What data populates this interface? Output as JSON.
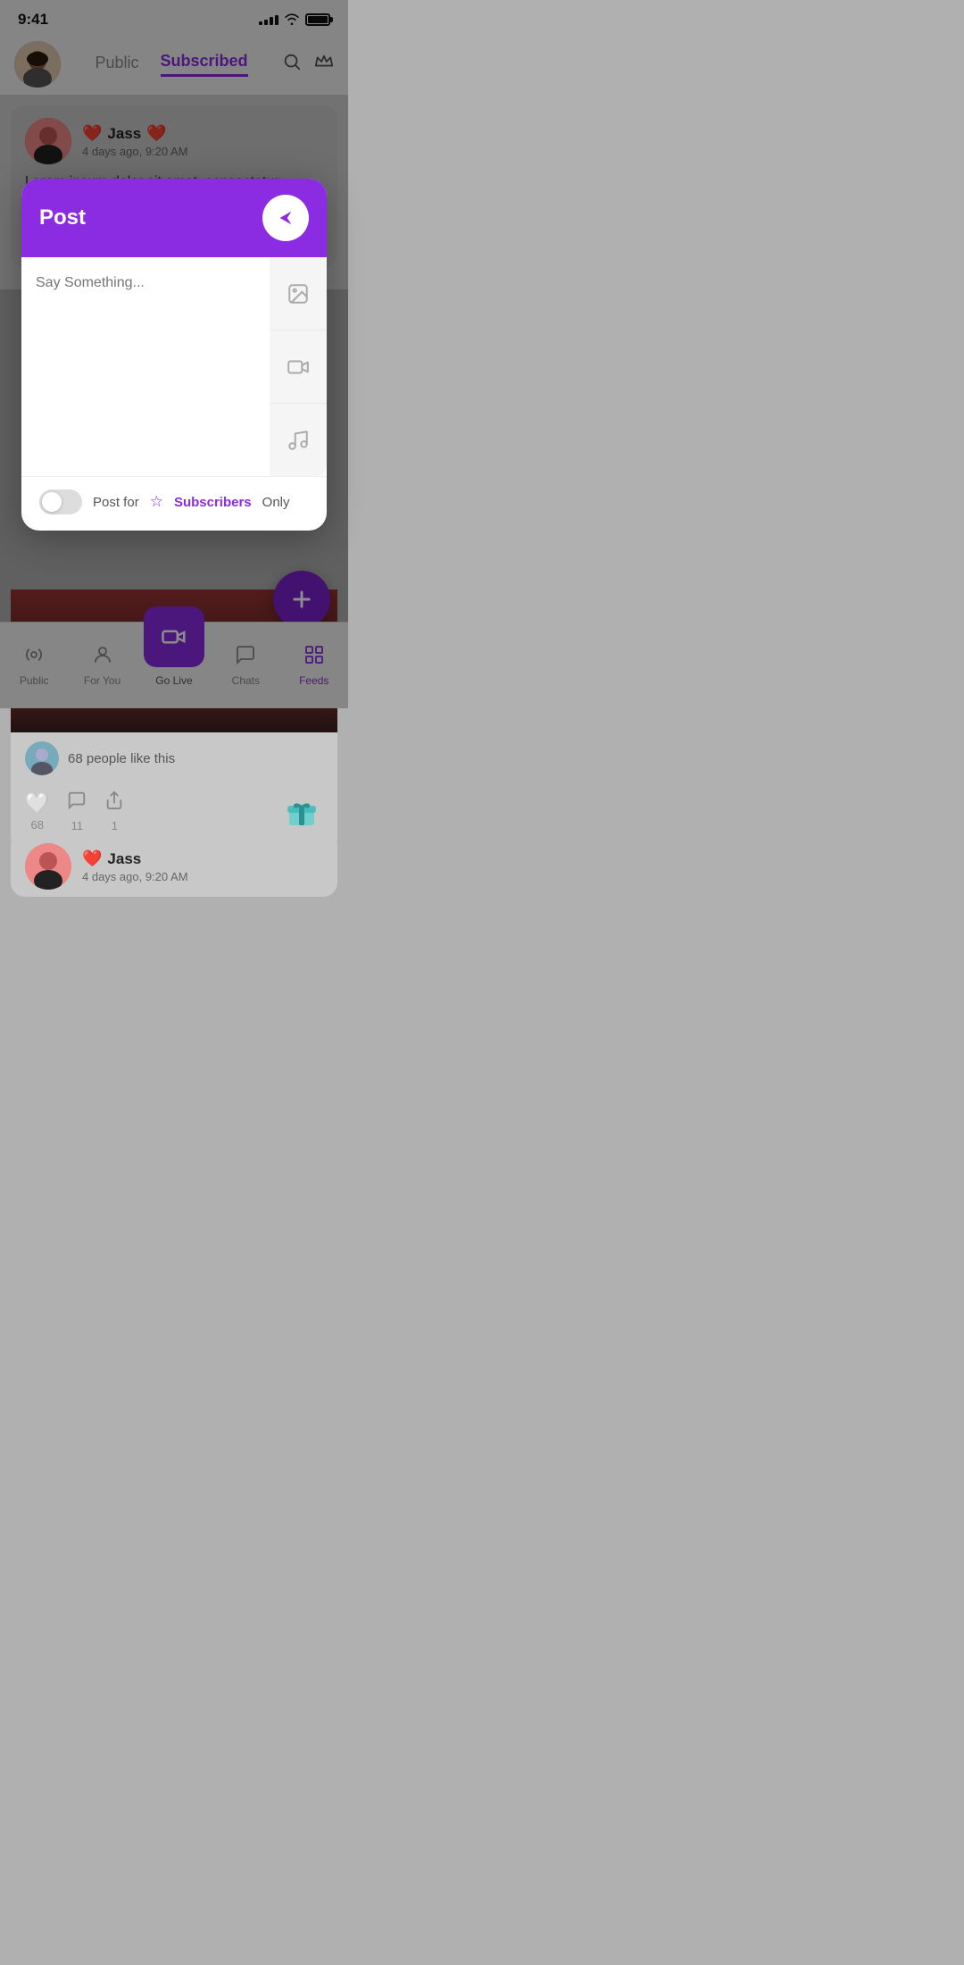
{
  "statusBar": {
    "time": "9:41",
    "signalBars": [
      3,
      5,
      7,
      9,
      11
    ],
    "battery": "full"
  },
  "header": {
    "tabs": [
      {
        "id": "public",
        "label": "Public",
        "active": false
      },
      {
        "id": "subscribed",
        "label": "Subscribed",
        "active": true
      }
    ],
    "searchIcon": "search",
    "crownIcon": "crown"
  },
  "posts": [
    {
      "author": "Jass",
      "time": "4 days ago, 9:20 AM",
      "text": "Lorem ipsum dolor sit amet, consectetur adipisicing elit, sed do eiusmod tempor incididunt  quis nostrud exercitation ullamco laboris nisi ut 🧡💛🧡",
      "likes": 68,
      "comments": 11,
      "shares": 1,
      "likeText": "68 people like this"
    },
    {
      "author": "Jass",
      "time": "4 days ago, 9:20 AM"
    }
  ],
  "modal": {
    "title": "Post",
    "placeholder": "Say Something...",
    "sendIcon": "send",
    "imageIcon": "image",
    "videoIcon": "video",
    "musicIcon": "music",
    "toggleLabel": "Post for",
    "subscribersLabel": "Subscribers",
    "onlyLabel": "Only",
    "toggleOn": false
  },
  "bottomNav": [
    {
      "id": "public",
      "label": "Public",
      "icon": "broadcast",
      "active": false
    },
    {
      "id": "for-you",
      "label": "For You",
      "icon": "person",
      "active": false
    },
    {
      "id": "go-live",
      "label": "Go Live",
      "icon": "camera",
      "active": false,
      "isCenter": true
    },
    {
      "id": "chats",
      "label": "Chats",
      "icon": "chat",
      "active": false
    },
    {
      "id": "feeds",
      "label": "Feeds",
      "icon": "feeds",
      "active": true
    }
  ]
}
